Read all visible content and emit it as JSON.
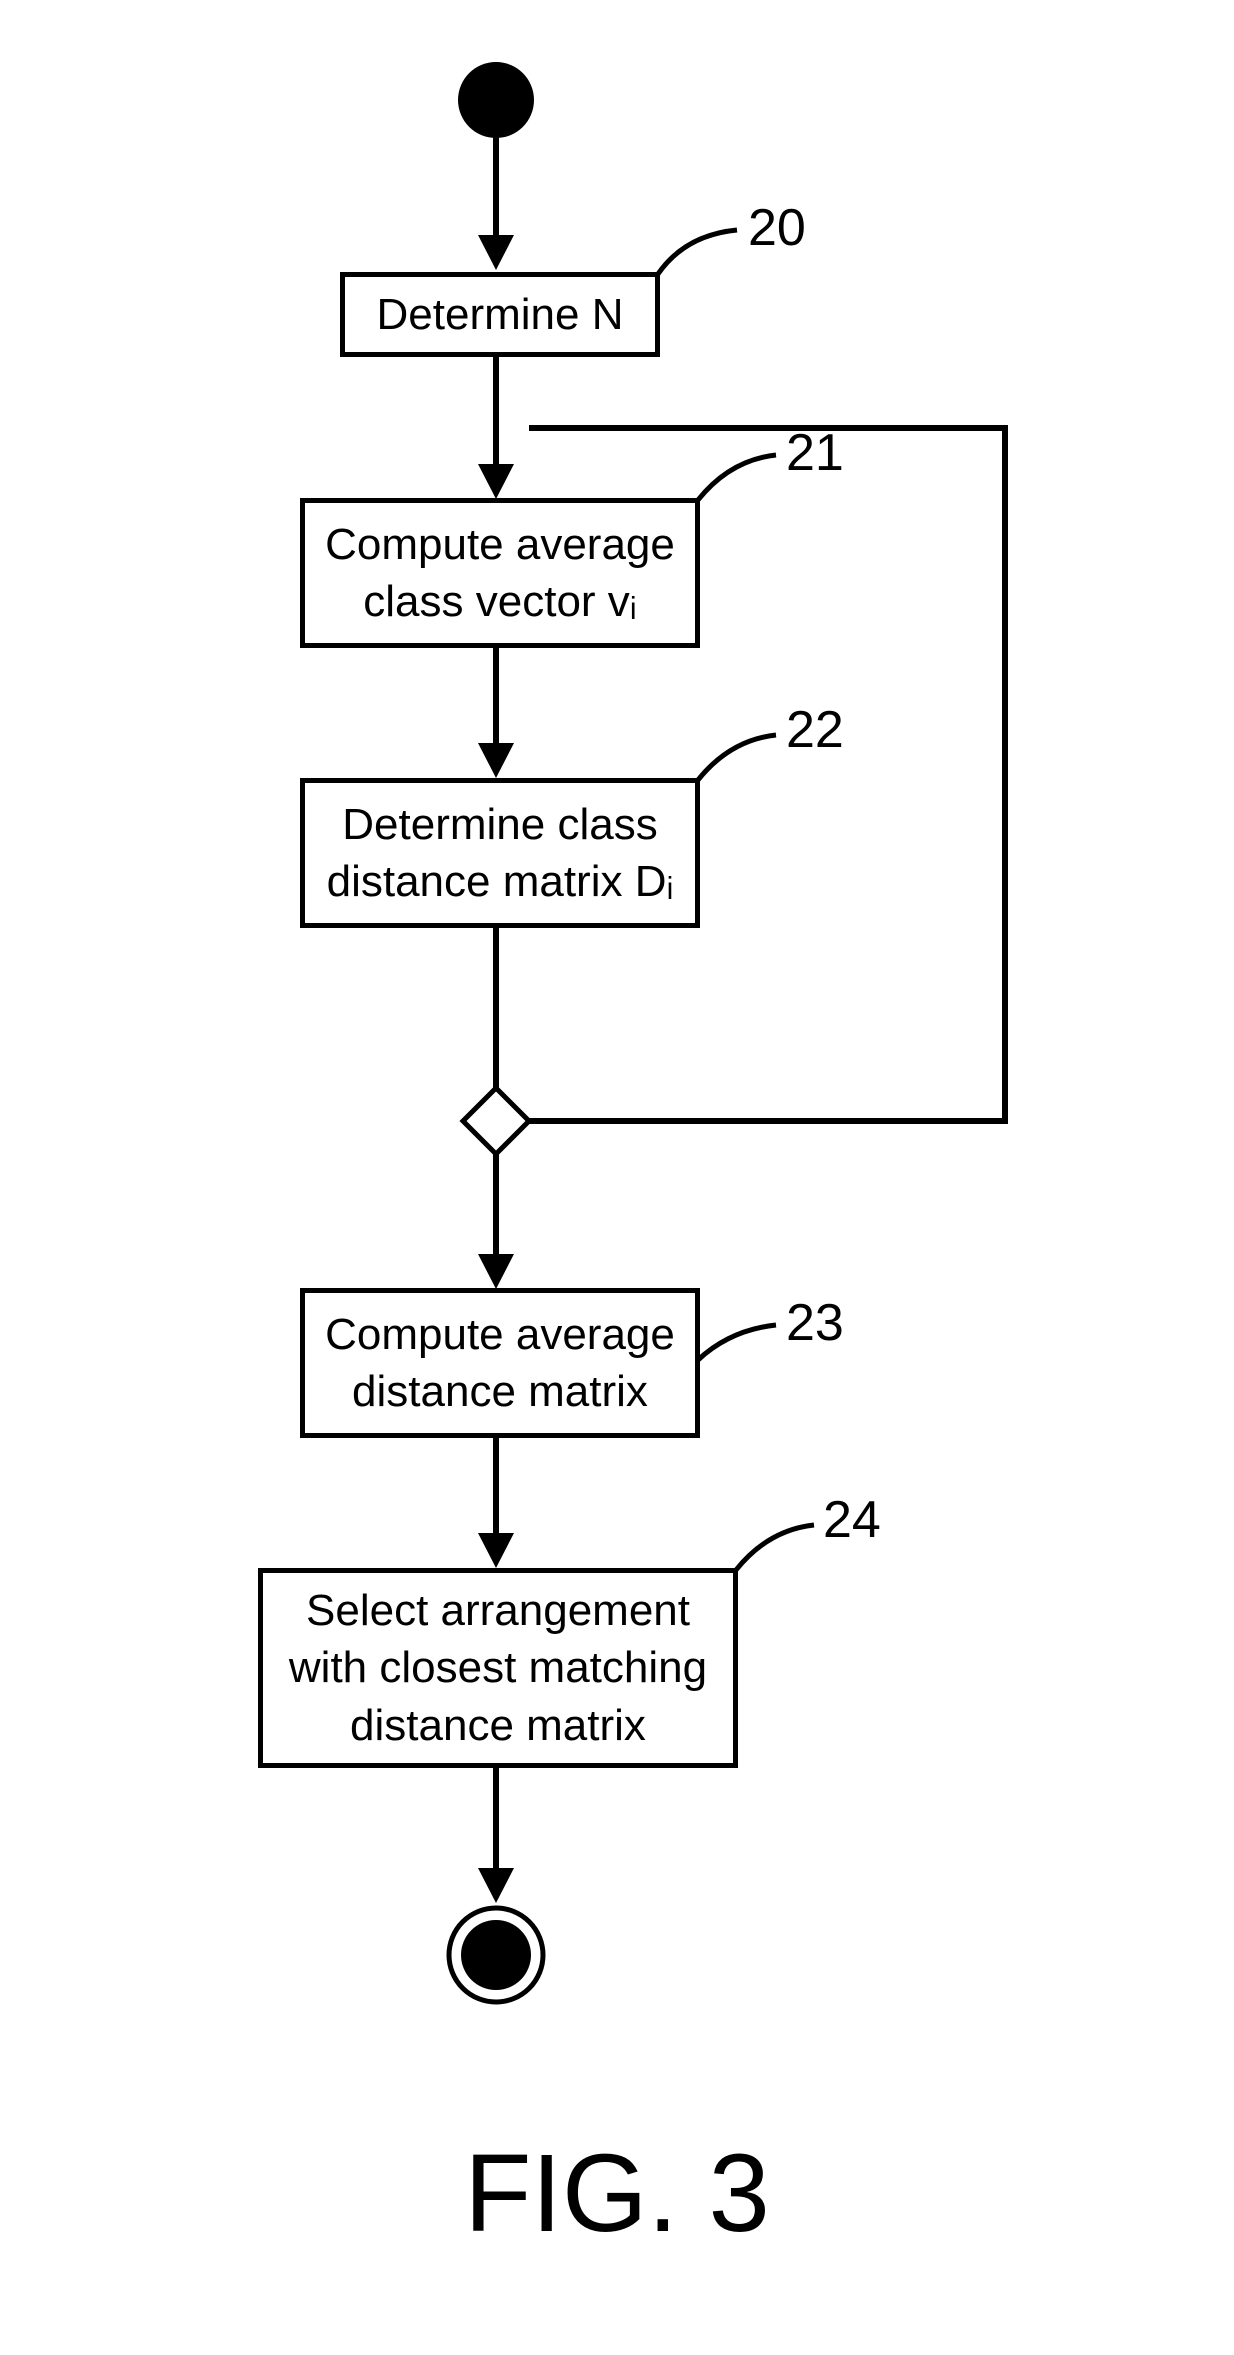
{
  "steps": {
    "s20": {
      "text": "Determine N",
      "ref": "20"
    },
    "s21": {
      "text": "Compute average class vector vᵢ",
      "ref": "21"
    },
    "s22": {
      "text": "Determine class distance matrix Dᵢ",
      "ref": "22"
    },
    "s23": {
      "text": "Compute average distance matrix",
      "ref": "23"
    },
    "s24": {
      "text": "Select arrangement with closest matching distance matrix",
      "ref": "24"
    }
  },
  "figure": "FIG. 3"
}
